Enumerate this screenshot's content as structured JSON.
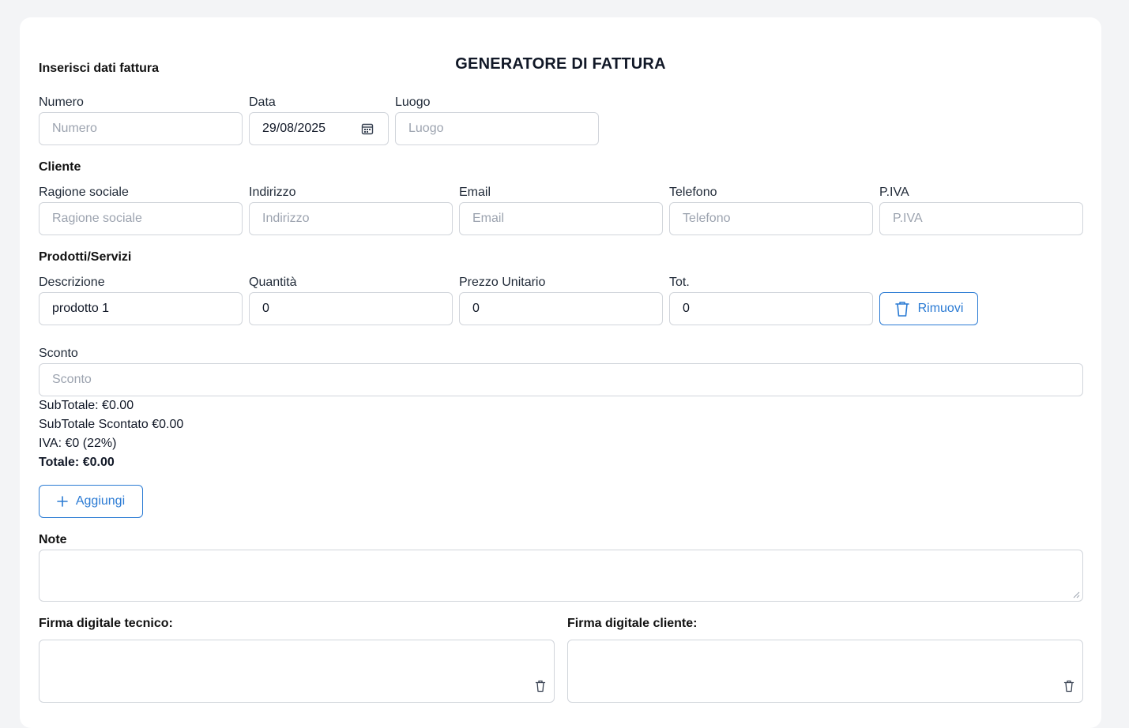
{
  "title": "GENERATORE DI FATTURA",
  "invoice": {
    "heading": "Inserisci dati fattura",
    "numero_label": "Numero",
    "numero_placeholder": "Numero",
    "data_label": "Data",
    "data_value": "29/08/2025",
    "luogo_label": "Luogo",
    "luogo_placeholder": "Luogo",
    "date_icon": "calendar-icon"
  },
  "cliente": {
    "heading": "Cliente",
    "ragione_label": "Ragione sociale",
    "ragione_placeholder": "Ragione sociale",
    "indirizzo_label": "Indirizzo",
    "indirizzo_placeholder": "Indirizzo",
    "email_label": "Email",
    "email_placeholder": "Email",
    "telefono_label": "Telefono",
    "telefono_placeholder": "Telefono",
    "piva_label": "P.IVA",
    "piva_placeholder": "P.IVA"
  },
  "prodotti": {
    "heading": "Prodotti/Servizi",
    "descrizione_label": "Descrizione",
    "quantita_label": "Quantità",
    "prezzo_label": "Prezzo Unitario",
    "tot_label": "Tot.",
    "rows": [
      {
        "descrizione": "prodotto 1",
        "quantita": "0",
        "prezzo": "0",
        "tot": "0"
      }
    ],
    "remove_label": "Rimuovi",
    "remove_icon": "trash-icon"
  },
  "sconto": {
    "label": "Sconto",
    "placeholder": "Sconto"
  },
  "totals": {
    "subtotale": "SubTotale: €0.00",
    "subtotale_scontato": "SubTotale Scontato €0.00",
    "iva": "IVA: €0 (22%)",
    "totale": "Totale: €0.00"
  },
  "add_button": {
    "label": "Aggiungi",
    "icon": "plus-icon"
  },
  "note": {
    "label": "Note"
  },
  "firme": {
    "tecnico_label": "Firma digitale tecnico:",
    "cliente_label": "Firma digitale cliente:",
    "clear_icon": "trash-icon"
  },
  "colors": {
    "accent": "#2b7bd4",
    "border": "#d1d5db",
    "background": "#f3f4f6",
    "card": "#ffffff"
  }
}
